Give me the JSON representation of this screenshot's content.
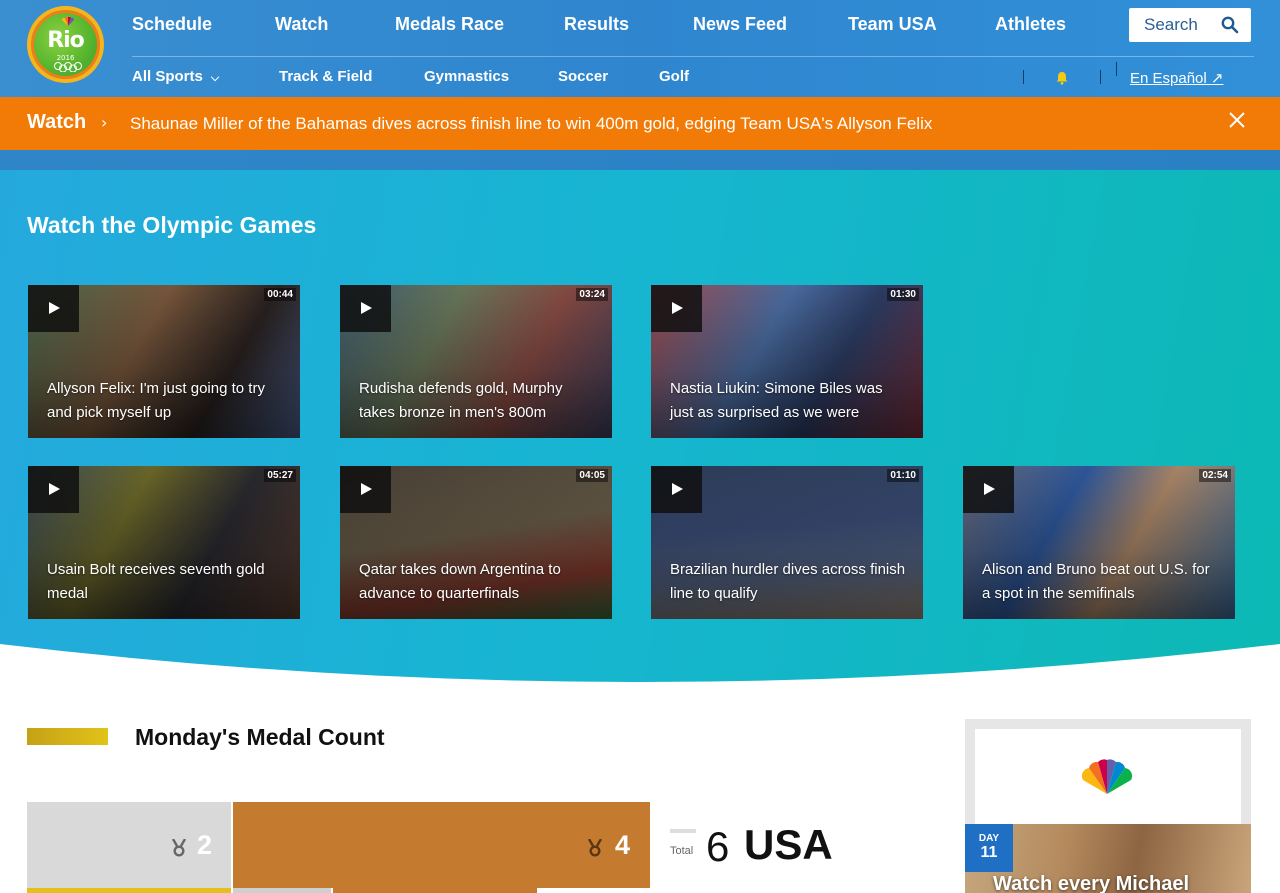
{
  "nav": {
    "primary": [
      "Schedule",
      "Watch",
      "Medals Race",
      "Results",
      "News Feed",
      "Team USA",
      "Athletes"
    ],
    "secondary": [
      "All Sports",
      "Track & Field",
      "Gymnastics",
      "Soccer",
      "Golf"
    ],
    "search_placeholder": "Search",
    "language_link": "En Español ↗"
  },
  "logo": {
    "text": "Rio",
    "year": "2016"
  },
  "alert": {
    "label": "Watch",
    "text": "Shaunae Miller of the Bahamas dives across finish line to win 400m gold, edging Team USA's Allyson Felix"
  },
  "watch": {
    "title": "Watch the Olympic Games",
    "videos": [
      {
        "caption": "Allyson Felix: I'm just going to try and pick myself up",
        "duration": "00:44"
      },
      {
        "caption": "Rudisha defends gold, Murphy takes bronze in men's 800m",
        "duration": "03:24"
      },
      {
        "caption": "Nastia Liukin: Simone Biles was just as surprised as we were",
        "duration": "01:30"
      },
      {
        "caption": "Usain Bolt receives seventh gold medal",
        "duration": "05:27"
      },
      {
        "caption": "Qatar takes down Argentina to advance to quarterfinals",
        "duration": "04:05"
      },
      {
        "caption": "Brazilian hurdler dives across finish line to qualify",
        "duration": "01:10"
      },
      {
        "caption": "Alison and Bruno beat out U.S. for a spot in the semifinals",
        "duration": "02:54"
      }
    ]
  },
  "medals": {
    "title": "Monday's Medal Count",
    "silver": "2",
    "bronze": "4",
    "total_label": "Total",
    "total": "6",
    "country": "USA"
  },
  "sidebar": {
    "day_label": "DAY",
    "day_number": "11",
    "headline": "Watch every Michael"
  },
  "colors": {
    "header": "#2f86cf",
    "alert": "#f27a06",
    "watch_bg_start": "#25a9dd",
    "watch_bg_end": "#0cb9b4",
    "silver": "#d9d9d9",
    "bronze": "#c47b2f",
    "gold": "#e1c319",
    "day_badge": "#1f6fc4"
  }
}
